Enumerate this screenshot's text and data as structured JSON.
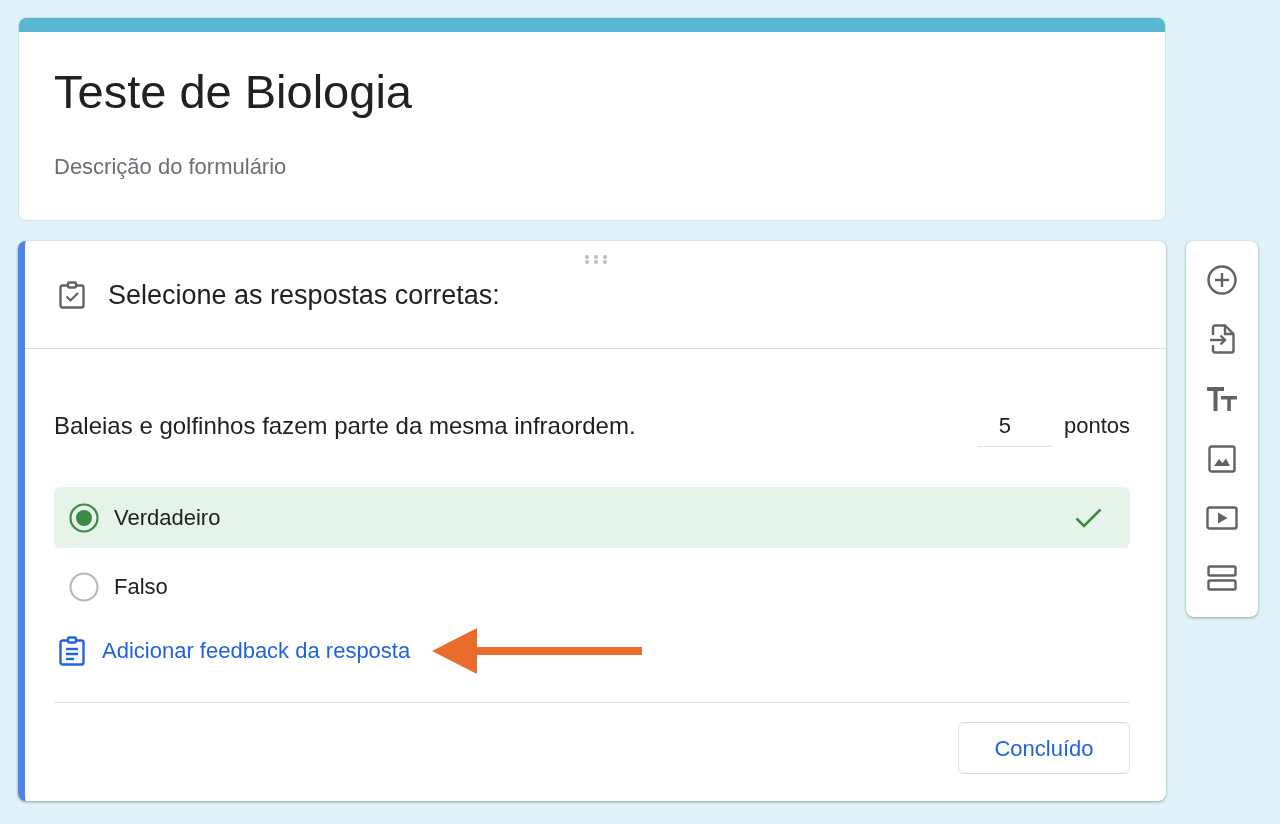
{
  "form_header": {
    "title": "Teste de Biologia",
    "description": "Descrição do formulário"
  },
  "question_card": {
    "active": true,
    "header": "Selecione as respostas corretas:",
    "question": "Baleias e golfinhos fazem parte da mesma infraordem.",
    "points": {
      "value": "5",
      "unit": "pontos"
    },
    "options": [
      {
        "label": "Verdadeiro",
        "selected": true
      },
      {
        "label": "Falso",
        "selected": false
      }
    ],
    "feedback_link": "Adicionar feedback da resposta",
    "done_button": "Concluído"
  }
}
